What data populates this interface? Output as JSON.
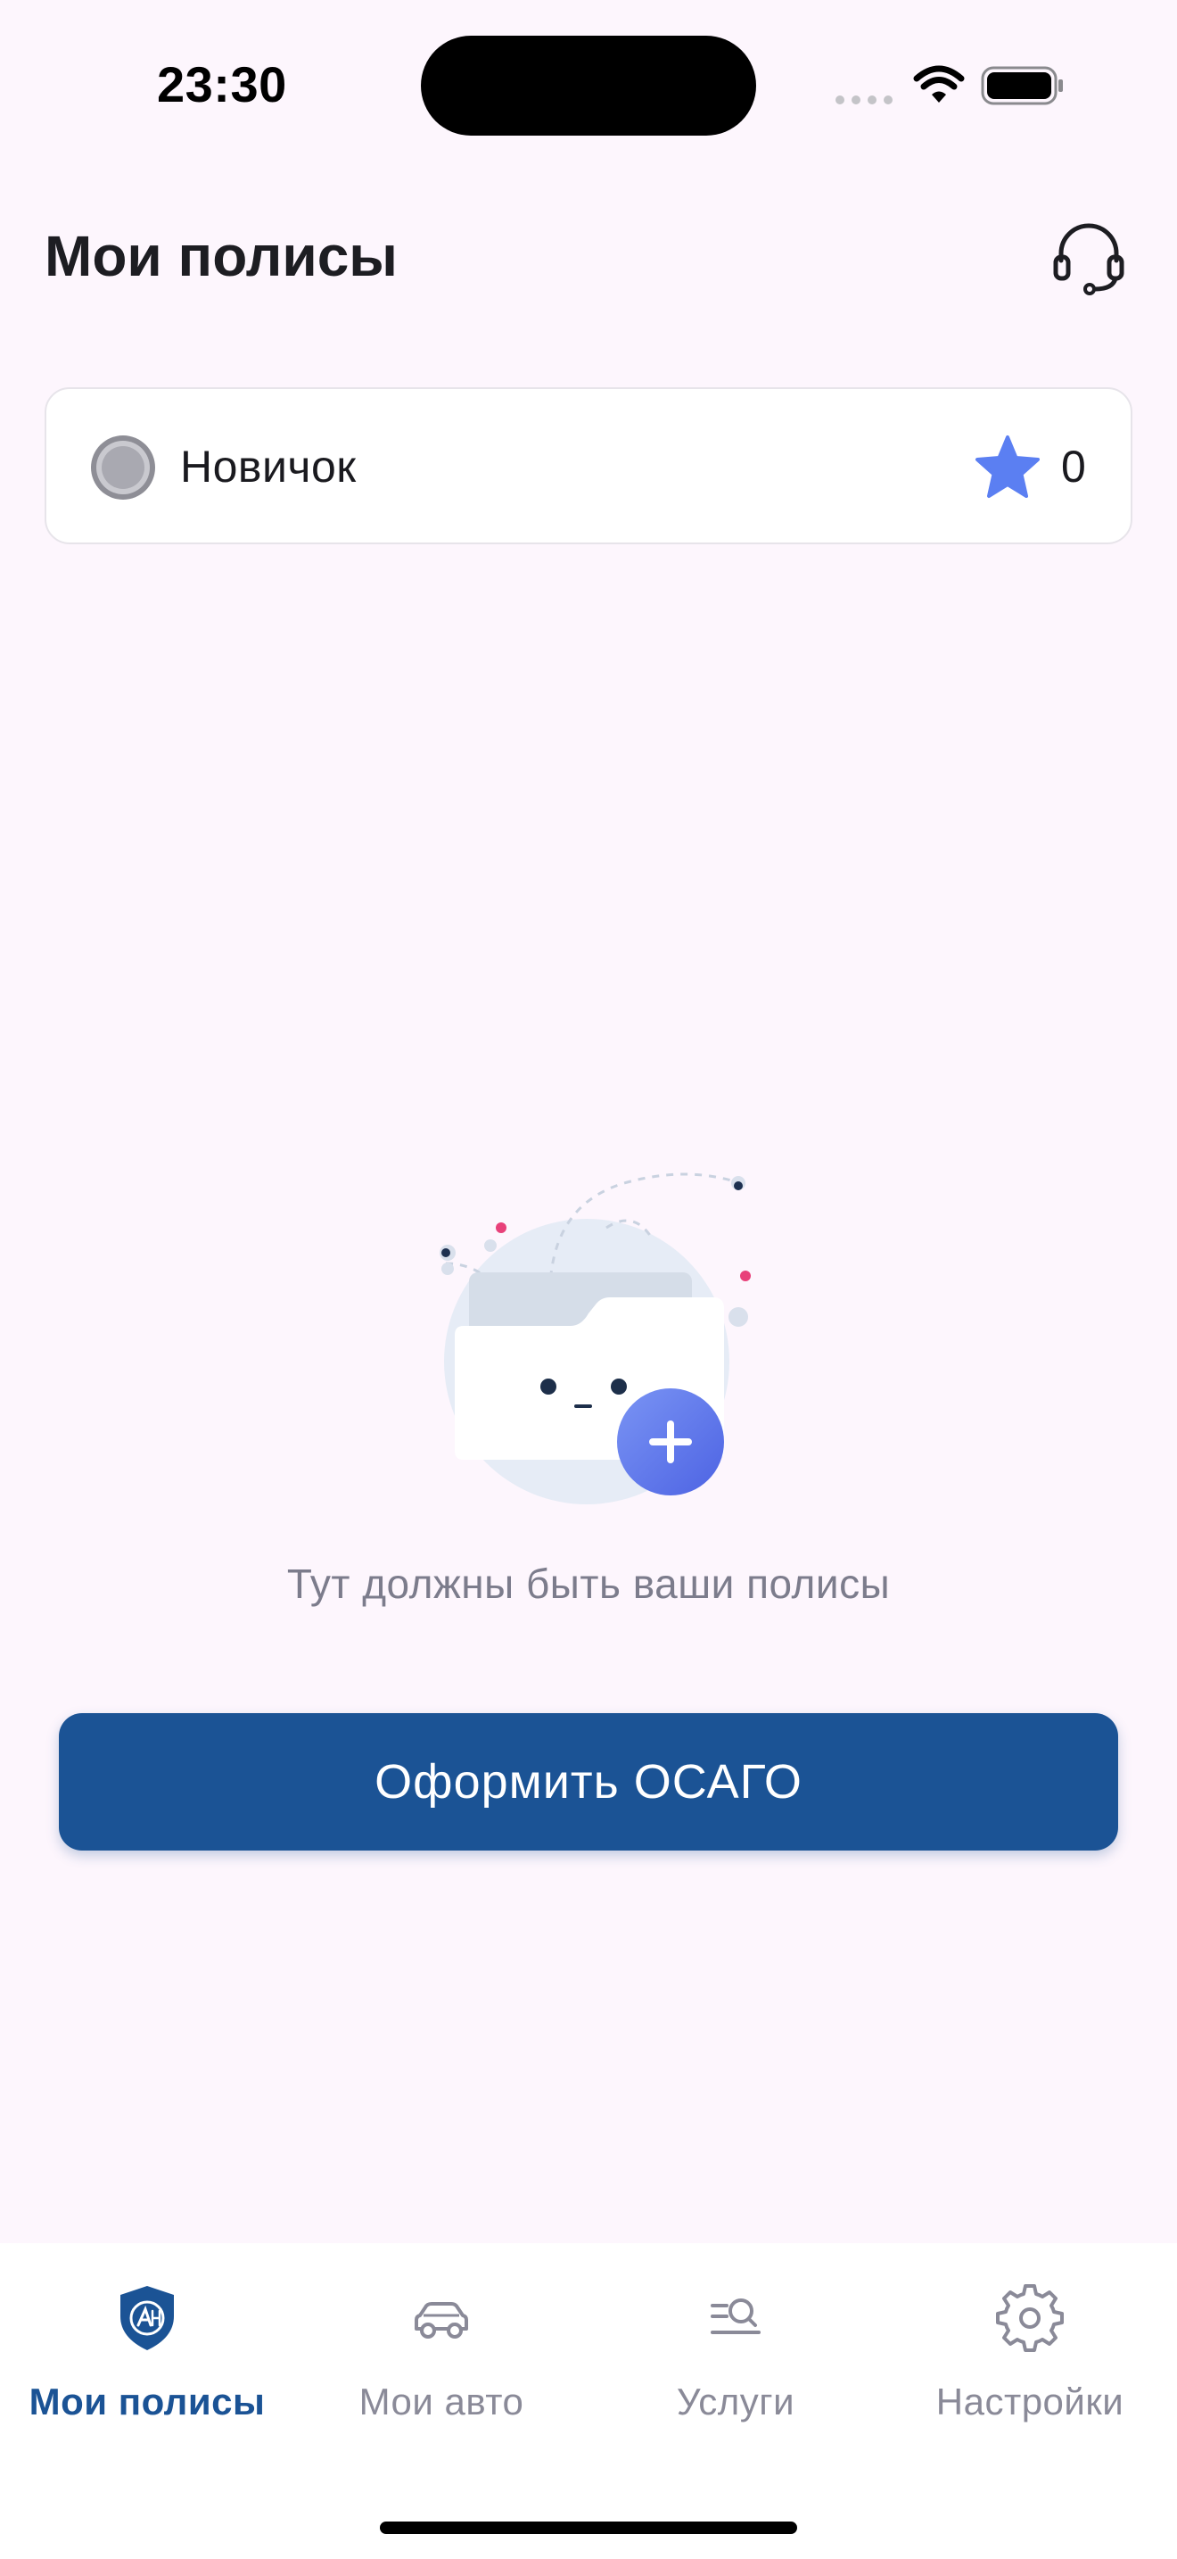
{
  "status_bar": {
    "time": "23:30"
  },
  "header": {
    "title": "Мои полисы",
    "support_icon": "headset-icon"
  },
  "level_card": {
    "level_name": "Новичок",
    "coin_icon": "silver-coin-icon",
    "star_icon": "star-icon",
    "points": "0"
  },
  "empty_state": {
    "illustration": "empty-folder-icon",
    "message": "Тут должны быть ваши полисы"
  },
  "cta": {
    "label": "Оформить ОСАГО"
  },
  "tab_bar": {
    "tabs": [
      {
        "label": "Мои полисы",
        "icon": "shield-logo-icon",
        "active": true
      },
      {
        "label": "Мои авто",
        "icon": "car-icon",
        "active": false
      },
      {
        "label": "Услуги",
        "icon": "services-search-icon",
        "active": false
      },
      {
        "label": "Настройки",
        "icon": "gear-icon",
        "active": false
      }
    ]
  },
  "colors": {
    "background": "#fdf6fd",
    "accent": "#1b5395",
    "star": "#5b7ff2",
    "muted_text": "#7c7c8c"
  }
}
